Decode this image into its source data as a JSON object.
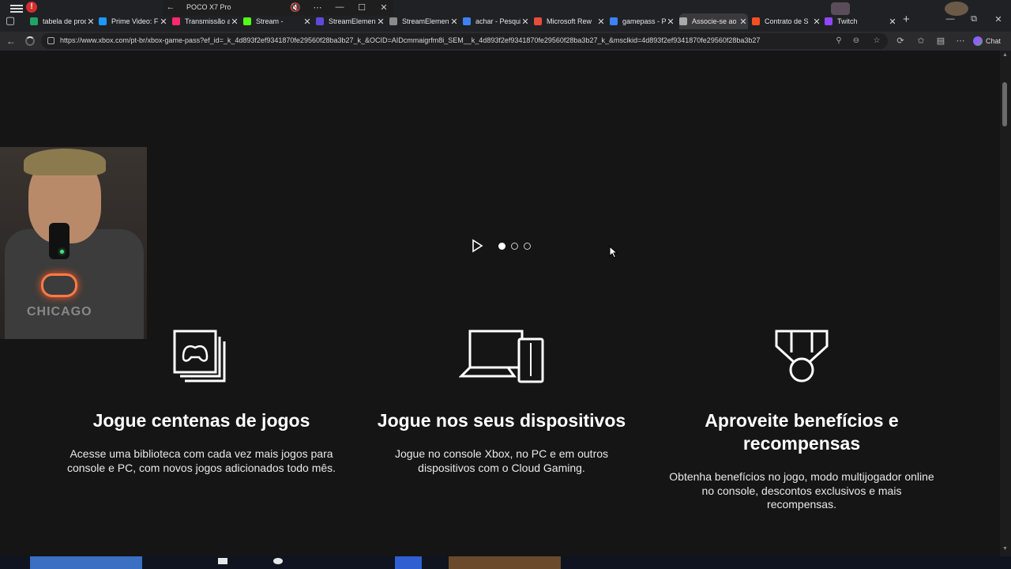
{
  "phone_window": {
    "title": "POCO X7 Pro"
  },
  "browser": {
    "tabs": [
      {
        "title": "tabela de prod",
        "color": "#21a366",
        "active": false
      },
      {
        "title": "Prime Video: F",
        "color": "#1a98ff",
        "active": false
      },
      {
        "title": "Transmissão ao",
        "color": "#ff2a6d",
        "active": false
      },
      {
        "title": "Stream -",
        "color": "#53fc18",
        "active": false
      },
      {
        "title": "StreamElemen",
        "color": "#5c4bdb",
        "active": false
      },
      {
        "title": "StreamElemen",
        "color": "#8a8a8a",
        "active": false
      },
      {
        "title": "achar - Pesqui",
        "color": "#3b82f6",
        "active": false
      },
      {
        "title": "Microsoft Rew",
        "color": "#e74c3c",
        "active": false
      },
      {
        "title": "gamepass - Pe",
        "color": "#3b82f6",
        "active": false
      },
      {
        "title": "Associe-se ao",
        "color": "#aaaaaa",
        "active": true
      },
      {
        "title": "Contrato de S",
        "color": "#f25022",
        "active": false
      },
      {
        "title": "Twitch",
        "color": "#9146ff",
        "active": false
      }
    ],
    "url": "https://www.xbox.com/pt-br/xbox-game-pass?ef_id=_k_4d893f2ef9341870fe29560f28ba3b27_k_&OCID=AIDcmmaigrfm8i_SEM__k_4d893f2ef9341870fe29560f28ba3b27_k_&msclkid=4d893f2ef9341870fe29560f28ba3b27",
    "chat_label": "Chat"
  },
  "carousel": {
    "slide_count": 3,
    "active_index": 0
  },
  "features": [
    {
      "icon": "game-library-icon",
      "title": "Jogue centenas de jogos",
      "description": "Acesse uma biblioteca com cada vez mais jogos para console e PC, com novos jogos adicionados todo mês."
    },
    {
      "icon": "devices-icon",
      "title": "Jogue nos seus dispositivos",
      "description": "Jogue no console Xbox, no PC e em outros dispositivos com o Cloud Gaming."
    },
    {
      "icon": "medal-icon",
      "title": "Aproveite benefícios e recompensas",
      "description": "Obtenha benefícios no jogo, modo multijogador online no console, descontos exclusivos e mais recompensas."
    }
  ],
  "webcam": {
    "shirt_text": "CHICAGO"
  }
}
